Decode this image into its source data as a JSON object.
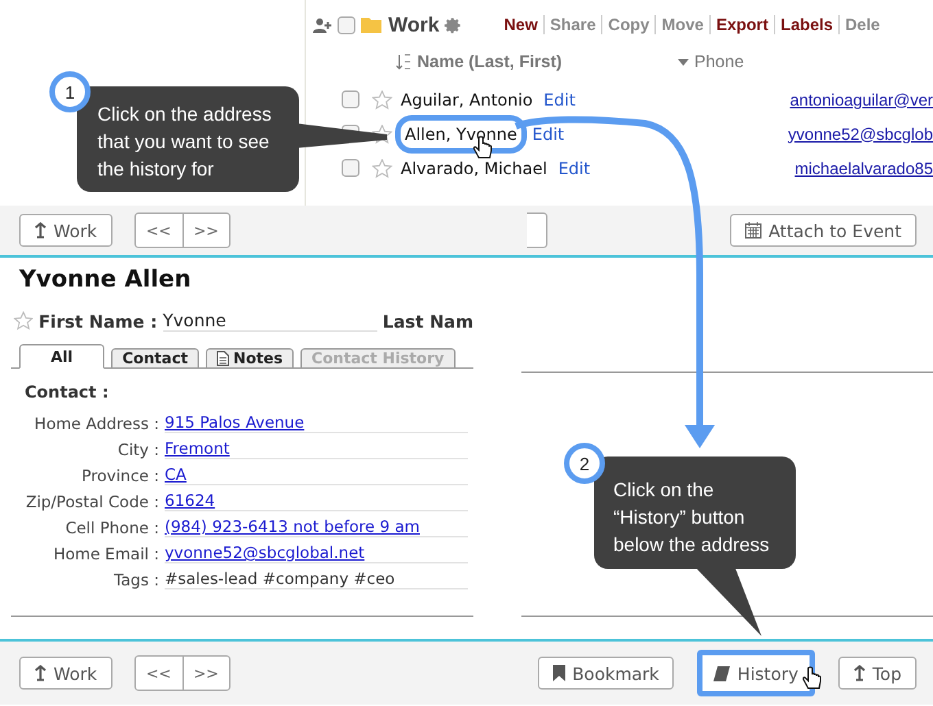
{
  "list": {
    "folder": "Work",
    "select_all_checked": false,
    "actions": [
      {
        "label": "New",
        "enabled": true
      },
      {
        "label": "Share",
        "enabled": false
      },
      {
        "label": "Copy",
        "enabled": false
      },
      {
        "label": "Move",
        "enabled": false
      },
      {
        "label": "Export",
        "enabled": true
      },
      {
        "label": "Labels",
        "enabled": true
      },
      {
        "label": "Dele",
        "enabled": false
      }
    ],
    "columns": [
      "Name (Last, First)",
      "Phone"
    ],
    "rows": [
      {
        "name": "Aguilar, Antonio",
        "edit": "Edit",
        "email": "antonioaguilar@ver",
        "checked": false,
        "highlighted": false
      },
      {
        "name": "Allen, Yvonne",
        "edit": "Edit",
        "email": "yvonne52@sbcglob",
        "checked": false,
        "highlighted": true
      },
      {
        "name": "Alvarado, Michael",
        "edit": "Edit",
        "email": "michaelalvarado85",
        "checked": false,
        "highlighted": false
      }
    ]
  },
  "detail": {
    "top_bar": {
      "back": "Work",
      "prev": "<<",
      "next": ">>",
      "attach": "Attach to Event"
    },
    "name": "Yvonne Allen",
    "first_name_label": "First Name :",
    "first_name": "Yvonne",
    "last_name_label": "Last Nam",
    "tabs": [
      {
        "label": "All",
        "selected": true,
        "disabled": false,
        "kind": "plain"
      },
      {
        "label": "Contact",
        "selected": false,
        "disabled": false,
        "kind": "plain"
      },
      {
        "label": "Notes",
        "selected": false,
        "disabled": false,
        "kind": "note"
      },
      {
        "label": "Contact History",
        "selected": false,
        "disabled": true,
        "kind": "plain"
      }
    ],
    "section": "Contact :",
    "fields": [
      {
        "label": "Home Address :",
        "value": "915 Palos Avenue",
        "kind": "link"
      },
      {
        "label": "City :",
        "value": "Fremont",
        "kind": "link"
      },
      {
        "label": "Province :",
        "value": "CA",
        "kind": "link"
      },
      {
        "label": "Zip/Postal Code :",
        "value": "61624",
        "kind": "link"
      },
      {
        "label": "Cell Phone :",
        "value": "(984) 923-6413 not before 9 am",
        "kind": "link"
      },
      {
        "label": "Home Email :",
        "value": "yvonne52@sbcglobal.net",
        "kind": "link"
      },
      {
        "label": "Tags :",
        "value": "#sales-lead #company #ceo",
        "kind": "text"
      }
    ],
    "bottom_bar": {
      "back": "Work",
      "prev": "<<",
      "next": ">>",
      "bookmark": "Bookmark",
      "history": "History",
      "history_highlighted": true,
      "top": "Top"
    }
  },
  "callouts": [
    {
      "number": "1",
      "text": "Click on the address that you want to see the history for"
    },
    {
      "number": "2",
      "text": "Click on the “History” button below the address"
    }
  ]
}
